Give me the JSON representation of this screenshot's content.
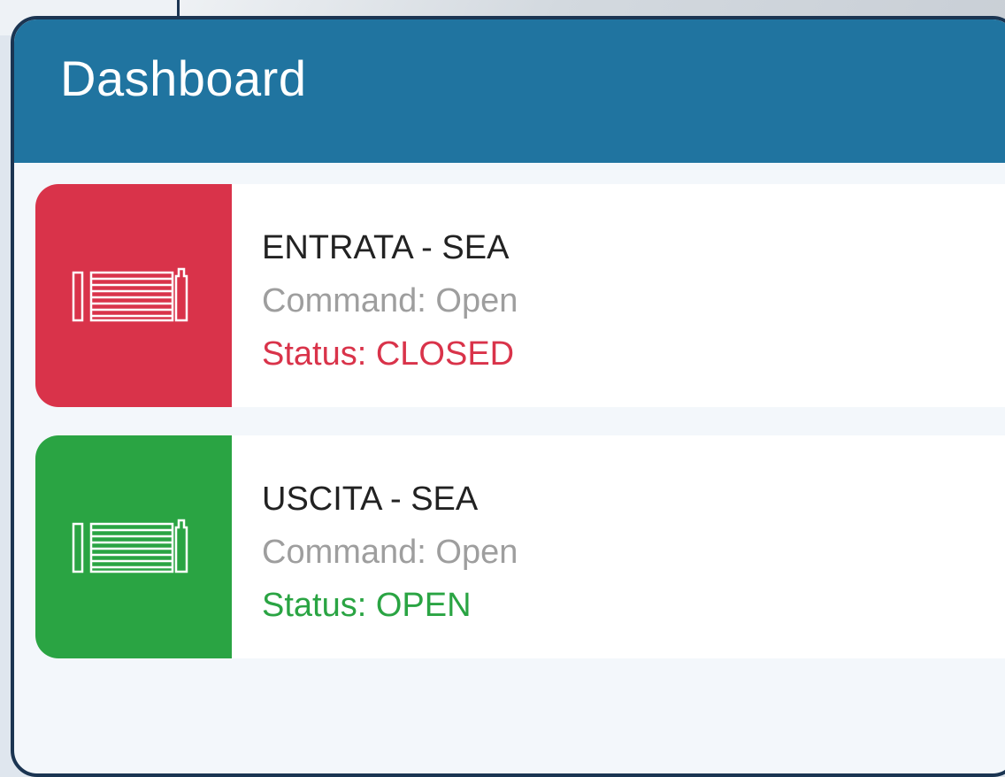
{
  "header": {
    "title": "Dashboard",
    "color": "#2074a0"
  },
  "gates": [
    {
      "name": "ENTRATA - SEA",
      "command": "Command: Open",
      "status": "Status: CLOSED",
      "status_color": "#d9334a",
      "icon": "gate-icon"
    },
    {
      "name": "USCITA - SEA",
      "command": "Command: Open",
      "status": "Status: OPEN",
      "status_color": "#2aa443",
      "icon": "gate-icon"
    }
  ]
}
